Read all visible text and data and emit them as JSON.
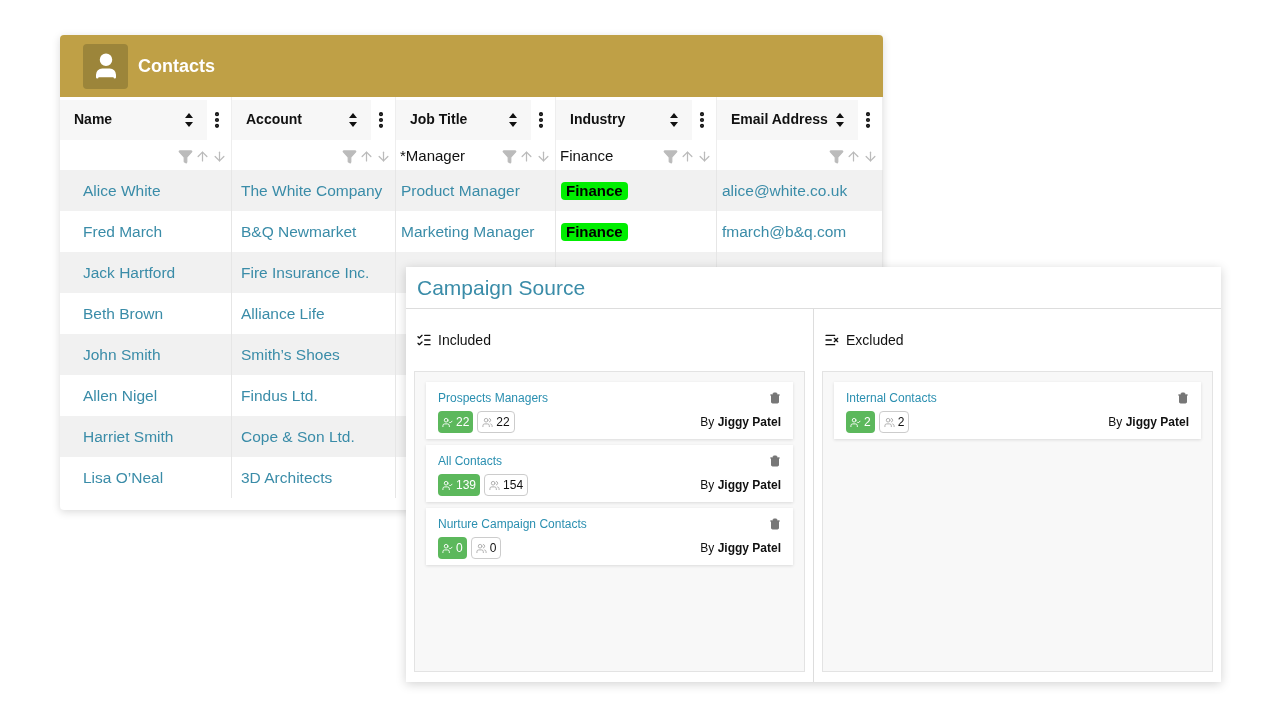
{
  "contacts": {
    "title": "Contacts",
    "columns": [
      {
        "label": "Name"
      },
      {
        "label": "Account"
      },
      {
        "label": "Job Title",
        "filter": "*Manager"
      },
      {
        "label": "Industry",
        "filter": "Finance"
      },
      {
        "label": "Email Address"
      }
    ],
    "rows": [
      {
        "name": "Alice White",
        "account": "The White Company",
        "job_title": "Product Manager",
        "industry": "Finance",
        "email": "alice@white.co.uk"
      },
      {
        "name": "Fred March",
        "account": "B&Q Newmarket",
        "job_title": "Marketing Manager",
        "industry": "Finance",
        "email": "fmarch@b&q.com"
      },
      {
        "name": "Jack Hartford",
        "account": "Fire Insurance Inc."
      },
      {
        "name": "Beth Brown",
        "account": "Alliance Life"
      },
      {
        "name": "John Smith",
        "account": "Smith’s Shoes"
      },
      {
        "name": "Allen Nigel",
        "account": "Findus Ltd."
      },
      {
        "name": "Harriet Smith",
        "account": "Cope & Son Ltd."
      },
      {
        "name": "Lisa O’Neal",
        "account": "3D Architects"
      }
    ]
  },
  "campaign_source": {
    "title": "Campaign Source",
    "sections": [
      {
        "kind": "included",
        "heading": "Included",
        "lists": [
          {
            "name": "Prospects Managers",
            "matched": "22",
            "total": "22",
            "author": "By **Jiggy Patel**"
          },
          {
            "name": "All Contacts",
            "matched": "139",
            "total": "154",
            "author": "By **Jiggy Patel**"
          },
          {
            "name": "Nurture Campaign Contacts",
            "matched": "0",
            "total": "0",
            "author": "By **Jiggy Patel**"
          }
        ]
      },
      {
        "kind": "excluded",
        "heading": "Excluded",
        "lists": [
          {
            "name": "Internal Contacts",
            "matched": "2",
            "total": "2",
            "author": "By **Jiggy Patel**"
          }
        ]
      }
    ]
  }
}
